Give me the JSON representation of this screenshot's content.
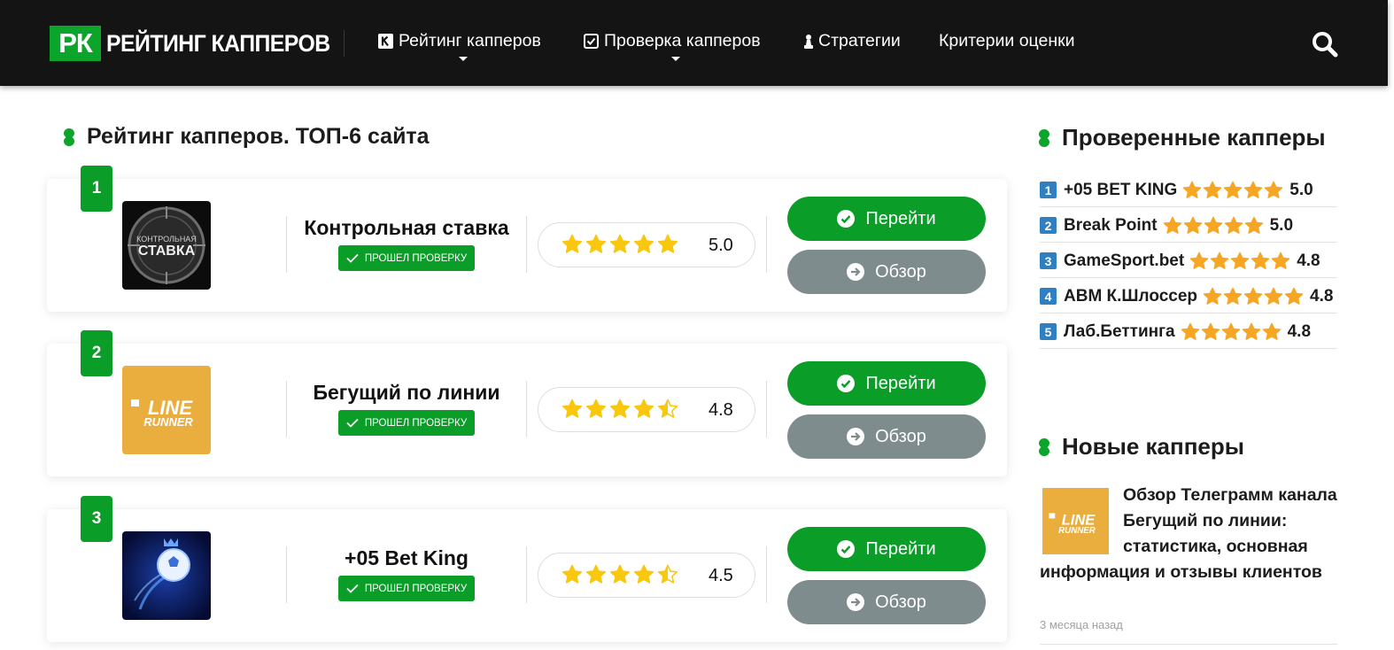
{
  "header": {
    "logo_badge": "РК",
    "logo_text": "РЕЙТИНГ КАППЕРОВ",
    "nav": [
      {
        "label": "Рейтинг капперов",
        "icon": "k-square-icon",
        "has_dropdown": true
      },
      {
        "label": "Проверка капперов",
        "icon": "checkbox-icon",
        "has_dropdown": true
      },
      {
        "label": "Стратегии",
        "icon": "chess-pawn-icon",
        "has_dropdown": false
      },
      {
        "label": "Критерии оценки",
        "icon": "",
        "has_dropdown": false
      }
    ],
    "search_icon": "search-icon"
  },
  "main": {
    "title": "Рейтинг капперов. ТОП-6 сайта",
    "cards": [
      {
        "rank": "1",
        "name": "Контрольная ставка",
        "verified": "ПРОШЕЛ ПРОВЕРКУ",
        "rating": 5.0,
        "rating_text": "5.0",
        "go": "Перейти",
        "review": "Обзор",
        "thumb": "kontrolnaya-stavka",
        "thumb_text": "СТАВКА",
        "thumb_small": "КОНТРОЛЬНАЯ"
      },
      {
        "rank": "2",
        "name": "Бегущий по линии",
        "verified": "ПРОШЕЛ ПРОВЕРКУ",
        "rating": 4.5,
        "rating_text": "4.8",
        "go": "Перейти",
        "review": "Обзор",
        "thumb": "line-runner",
        "thumb_text": "LINE",
        "thumb_small": "RUNNER"
      },
      {
        "rank": "3",
        "name": "+05 Bet King",
        "verified": "ПРОШЕЛ ПРОВЕРКУ",
        "rating": 4.5,
        "rating_text": "4.5",
        "go": "Перейти",
        "review": "Обзор",
        "thumb": "bet-king",
        "thumb_text": "",
        "thumb_small": ""
      }
    ]
  },
  "sidebar": {
    "checked_title": "Проверенные капперы",
    "top": [
      {
        "num": "1",
        "name": "+05 BET KING",
        "score": "5.0"
      },
      {
        "num": "2",
        "name": "Break Point",
        "score": "5.0"
      },
      {
        "num": "3",
        "name": "GameSport.bet",
        "score": "4.8"
      },
      {
        "num": "4",
        "name": "ABM К.Шлоссер",
        "score": "4.8"
      },
      {
        "num": "5",
        "name": "Лаб.Беттинга",
        "score": "4.8"
      }
    ],
    "new_title": "Новые капперы",
    "news": {
      "text": "Обзор Телеграмм канала Бегущий по линии: статистика, основная информация и отзывы клиентов",
      "date": "3 месяца назад"
    }
  },
  "colors": {
    "header_bg": "#141414",
    "brand_green": "#0aa52a",
    "review_grey": "#7f8c8d",
    "star_yellow": "#f9c80e",
    "star_orange": "#f6a623",
    "badge_blue": "#2f7fc1"
  }
}
